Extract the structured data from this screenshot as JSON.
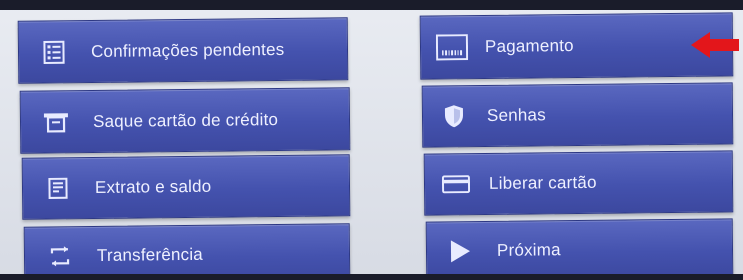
{
  "menu": {
    "left": [
      {
        "label": "Confirmações pendentes",
        "icon": "checklist-icon"
      },
      {
        "label": "Saque cartão de crédito",
        "icon": "cash-withdraw-icon"
      },
      {
        "label": "Extrato e saldo",
        "icon": "statement-icon"
      },
      {
        "label": "Transferência",
        "icon": "transfer-icon"
      }
    ],
    "right": [
      {
        "label": "Pagamento",
        "icon": "barcode-icon"
      },
      {
        "label": "Senhas",
        "icon": "shield-icon"
      },
      {
        "label": "Liberar cartão",
        "icon": "card-icon"
      },
      {
        "label": "Próxima",
        "icon": "play-next-icon"
      }
    ]
  },
  "annotation": {
    "icon": "red-arrow-icon",
    "color": "#e3161b"
  },
  "colors": {
    "button": "#4452ae",
    "button_text": "#eef0ff",
    "background": "#e3e6ee"
  }
}
